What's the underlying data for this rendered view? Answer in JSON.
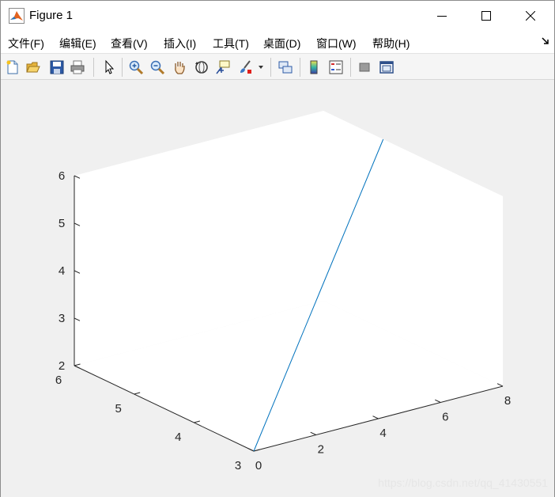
{
  "window": {
    "title": "Figure 1"
  },
  "menubar": {
    "items": [
      {
        "label": "文件(F)"
      },
      {
        "label": "编辑(E)"
      },
      {
        "label": "查看(V)"
      },
      {
        "label": "插入(I)"
      },
      {
        "label": "工具(T)"
      },
      {
        "label": "桌面(D)"
      },
      {
        "label": "窗口(W)"
      },
      {
        "label": "帮助(H)"
      }
    ]
  },
  "toolbar": {
    "buttons": [
      "new-figure-icon",
      "open-file-icon",
      "save-icon",
      "print-icon",
      "pointer-icon",
      "zoom-in-icon",
      "zoom-out-icon",
      "pan-hand-icon",
      "rotate-3d-icon",
      "data-cursor-icon",
      "brush-icon",
      "link-plot-icon",
      "colorbar-icon",
      "legend-icon",
      "hide-plot-tools-icon",
      "show-plot-tools-icon"
    ]
  },
  "chart_data": {
    "type": "line",
    "projection": "3d",
    "series": [
      {
        "x": [
          0,
          4,
          8
        ],
        "y": [
          3,
          4,
          5
        ],
        "z": [
          2,
          4,
          6
        ],
        "color": "#0072BD"
      }
    ],
    "xlim": [
      0,
      8
    ],
    "ylim": [
      3,
      6
    ],
    "zlim": [
      2,
      6
    ],
    "xticks": [
      "0",
      "2",
      "4",
      "6",
      "8"
    ],
    "yticks": [
      "3",
      "4",
      "5",
      "6"
    ],
    "zticks": [
      "2",
      "3",
      "4",
      "5",
      "6"
    ],
    "grid": false
  },
  "watermark": "https://blog.csdn.net/qq_41430551"
}
